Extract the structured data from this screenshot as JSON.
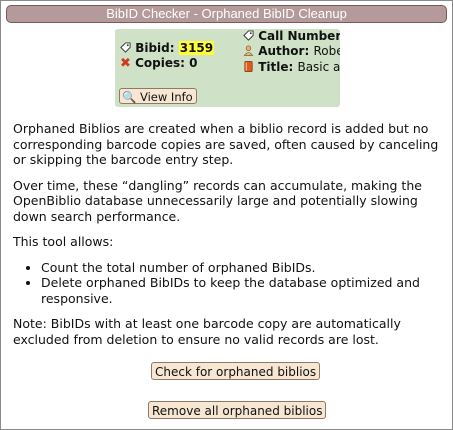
{
  "title": "BibID Checker - Orphaned BibID Cleanup",
  "card": {
    "bibid_label": "Bibid:",
    "bibid_value": "3159",
    "copies_label": "Copies:",
    "copies_value": "0",
    "callnumber_label": "Call Number:",
    "author_label": "Author:",
    "author_value": "Rober",
    "title_label": "Title:",
    "title_value": "Basic acc",
    "view_info_label": "View Info"
  },
  "content": {
    "p1": "Orphaned Biblios are created when a biblio record is added but no corresponding barcode copies are saved, often caused by canceling or skipping the barcode entry step.",
    "p2": "Over time, these “dangling” records can accumulate, making the OpenBiblio database unnecessarily large and potentially slowing down search performance.",
    "p3": "This tool allows:",
    "bullets": [
      "Count the total number of orphaned BibIDs.",
      "Delete orphaned BibIDs to keep the database optimized and responsive."
    ],
    "note": "Note: BibIDs with at least one barcode copy are automatically excluded from deletion to ensure no valid records are lost."
  },
  "buttons": {
    "check": "Check for orphaned biblios",
    "remove": "Remove all orphaned biblios"
  },
  "colors": {
    "titlebar": "#b49a9a",
    "card_bg": "#cfe1c6",
    "button_bg": "#f6e6d2",
    "highlight": "#ffff33"
  }
}
